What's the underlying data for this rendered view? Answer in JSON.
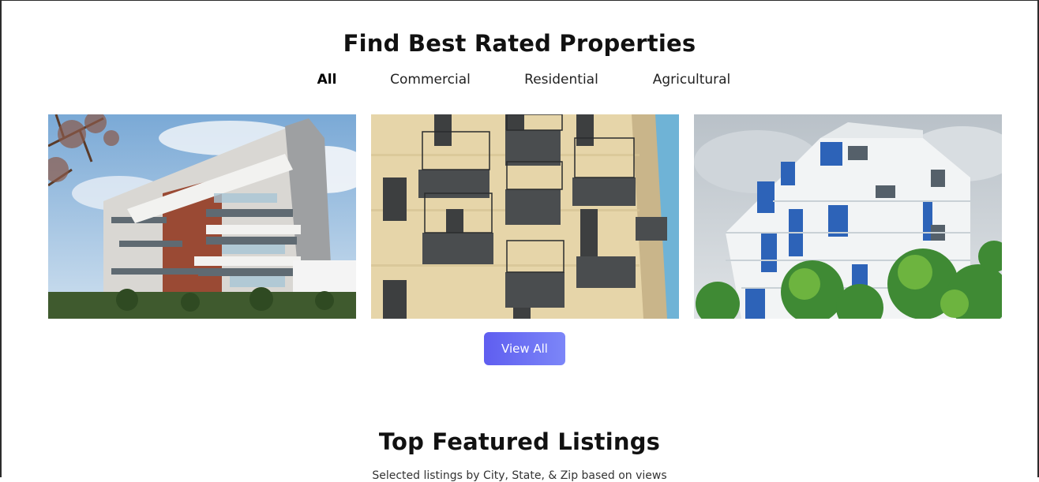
{
  "properties_section": {
    "title": "Find Best Rated Properties",
    "filters": [
      {
        "label": "All",
        "active": true
      },
      {
        "label": "Commercial",
        "active": false
      },
      {
        "label": "Residential",
        "active": false
      },
      {
        "label": "Agricultural",
        "active": false
      }
    ],
    "view_all_label": "View All",
    "colors": {
      "button_start": "#5f5ef0",
      "button_end": "#7c86f8"
    }
  },
  "featured_section": {
    "title": "Top Featured Listings",
    "subtitle": "Selected listings by City, State, & Zip based on views"
  }
}
